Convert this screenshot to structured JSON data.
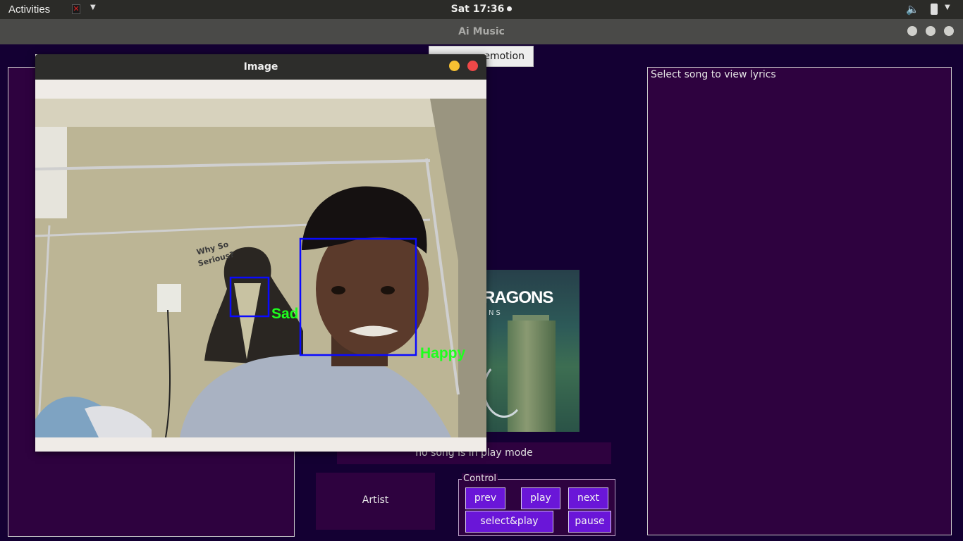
{
  "topbar": {
    "activities": "Activities",
    "clock": "Sat 17:36"
  },
  "window": {
    "title": "Ai Music"
  },
  "emotion_button": {
    "label": "emotion"
  },
  "lyrics": {
    "placeholder": "Select song to view lyrics"
  },
  "album": {
    "title": "RAGONS",
    "subtitle": "NS"
  },
  "status": {
    "text": "no song is in play mode"
  },
  "artist": {
    "label": "Artist"
  },
  "controls": {
    "legend": "Control",
    "prev": "prev",
    "play": "play",
    "next": "next",
    "select_play": "select&play",
    "pause": "pause"
  },
  "image_window": {
    "title": "Image",
    "wall_text": "Why So Serious?",
    "detections": [
      {
        "label": "Sad"
      },
      {
        "label": "Happy"
      }
    ]
  },
  "colors": {
    "background": "#140033",
    "panel": "#2e023f",
    "button": "#6a16d8",
    "detection_box": "#0a0aff",
    "detection_label": "#1eff1e"
  }
}
